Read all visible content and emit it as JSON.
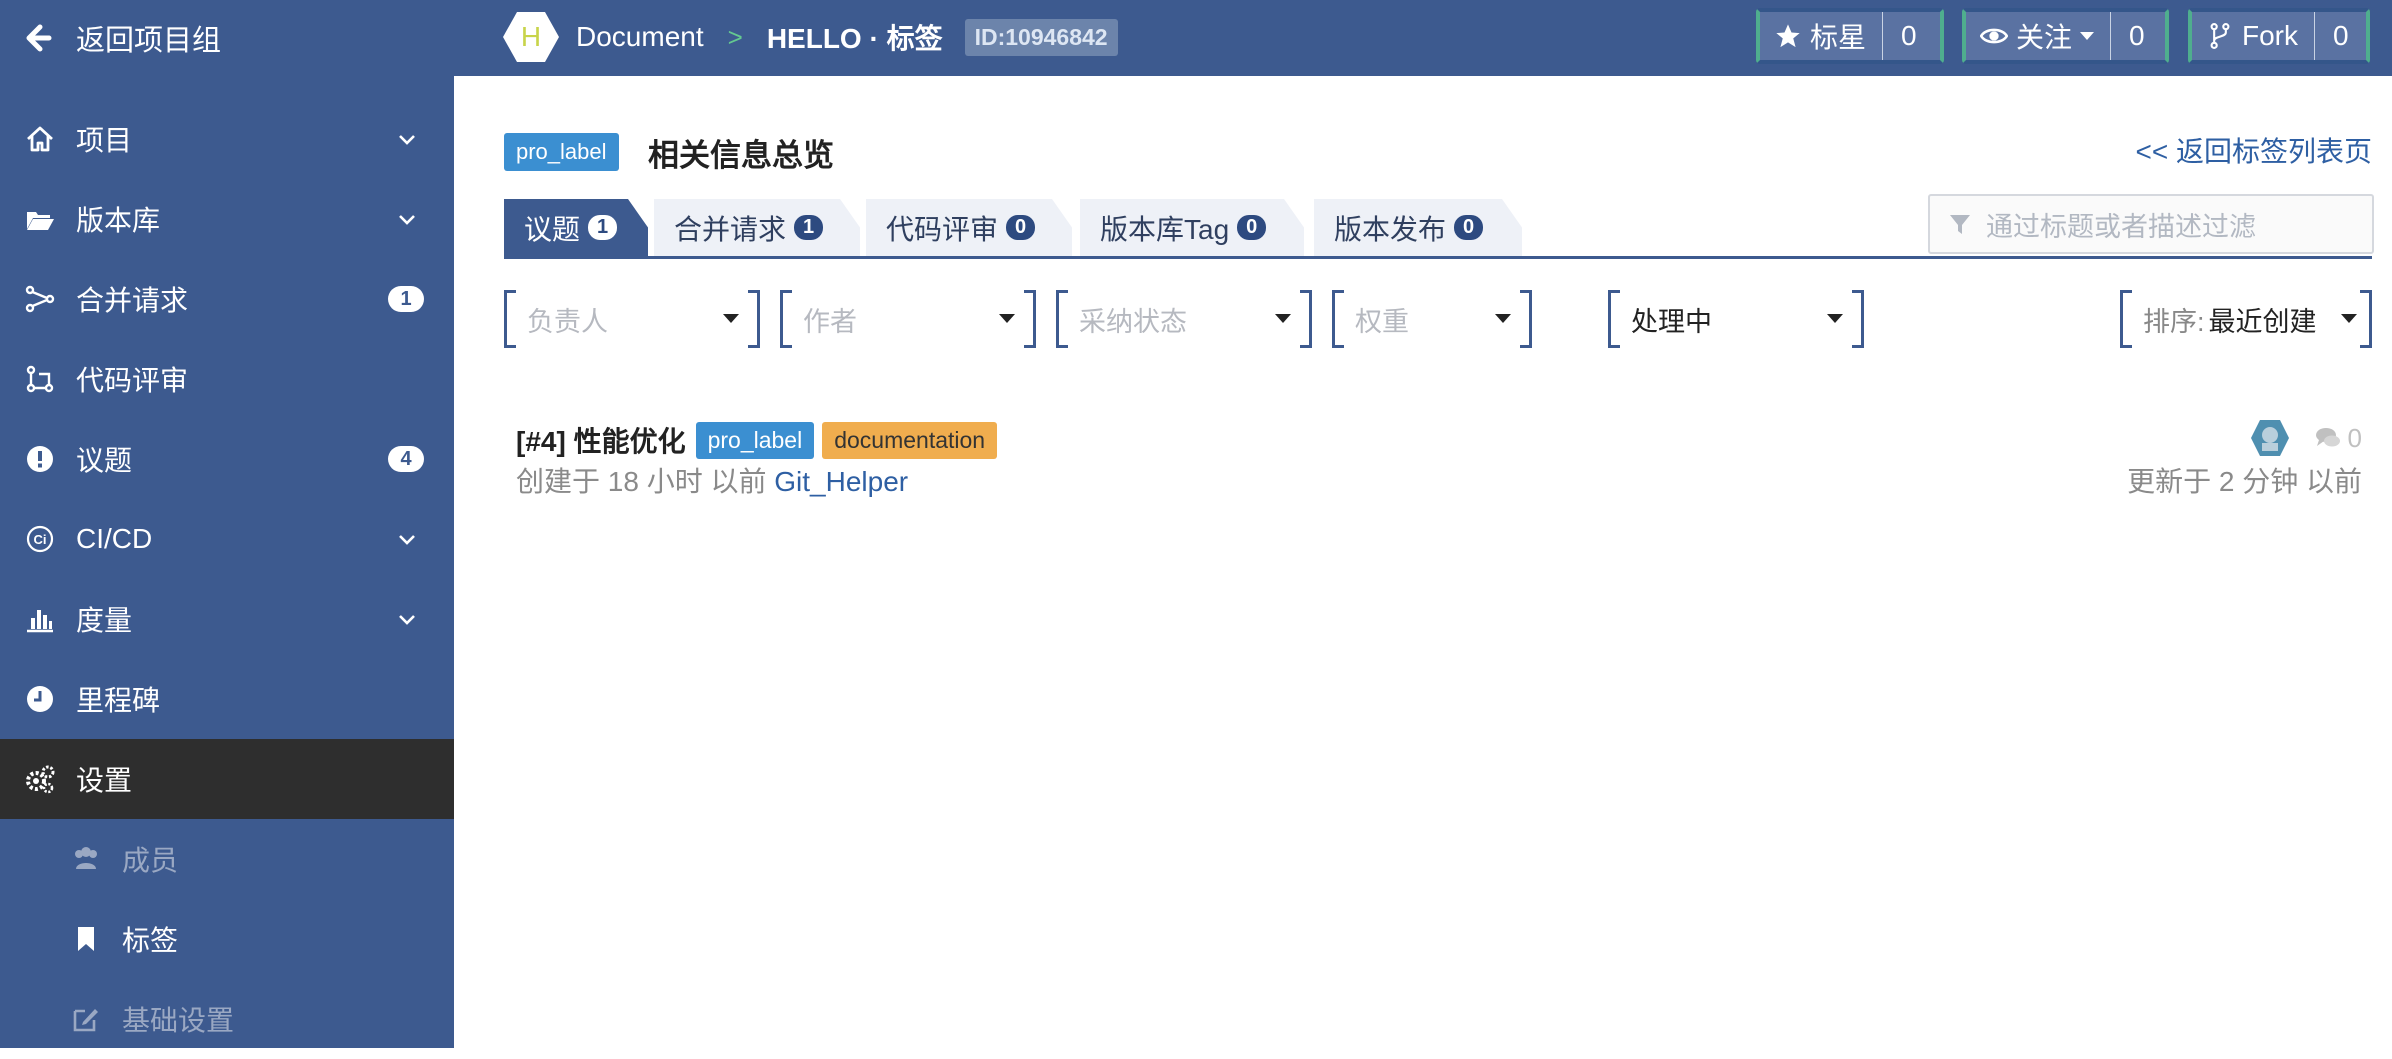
{
  "topbar": {
    "back_label": "返回项目组",
    "project_logo_letter": "H",
    "breadcrumb_group": "Document",
    "breadcrumb_sep": ">",
    "breadcrumb_current": "HELLO · 标签",
    "project_id": "ID:10946842",
    "star": {
      "label": "标星",
      "count": "0"
    },
    "watch": {
      "label": "关注",
      "count": "0"
    },
    "fork": {
      "label": "Fork",
      "count": "0"
    }
  },
  "sidebar": {
    "items": [
      {
        "label": "项目",
        "icon": "home-icon",
        "chevron": true
      },
      {
        "label": "版本库",
        "icon": "folder-open-icon",
        "chevron": true
      },
      {
        "label": "合并请求",
        "icon": "merge-request-icon",
        "badge": "1"
      },
      {
        "label": "代码评审",
        "icon": "code-review-icon"
      },
      {
        "label": "议题",
        "icon": "exclamation-circle-icon",
        "badge": "4"
      },
      {
        "label": "CI/CD",
        "icon": "ci-icon",
        "chevron": true
      },
      {
        "label": "度量",
        "icon": "bar-chart-icon",
        "chevron": true
      },
      {
        "label": "里程碑",
        "icon": "clock-icon"
      },
      {
        "label": "设置",
        "icon": "gears-icon",
        "active": true
      }
    ],
    "sub_items": [
      {
        "label": "成员",
        "icon": "users-icon"
      },
      {
        "label": "标签",
        "icon": "bookmark-icon"
      },
      {
        "label": "基础设置",
        "icon": "edit-icon"
      }
    ]
  },
  "main": {
    "label_name": "pro_label",
    "title": "相关信息总览",
    "back_link": "<< 返回标签列表页",
    "tabs": [
      {
        "label": "议题",
        "count": "1",
        "active": true
      },
      {
        "label": "合并请求",
        "count": "1"
      },
      {
        "label": "代码评审",
        "count": "0"
      },
      {
        "label": "版本库Tag",
        "count": "0"
      },
      {
        "label": "版本发布",
        "count": "0"
      }
    ],
    "filter_placeholder": "通过标题或者描述过滤",
    "dropdowns": {
      "assignee": "负责人",
      "author": "作者",
      "adoption": "采纳状态",
      "weight": "权重",
      "status": "处理中",
      "sort_prefix": "排序:",
      "sort_value": "最近创建"
    },
    "issue": {
      "title": "[#4] 性能优化",
      "labels": [
        {
          "name": "pro_label",
          "color": "#3b8fd1"
        },
        {
          "name": "documentation",
          "color": "#f0ad4e"
        }
      ],
      "created_prefix": "创建于 18 小时 以前",
      "author": "Git_Helper",
      "comment_count": "0",
      "updated": "更新于 2 分钟 以前"
    }
  },
  "colors": {
    "sidebar_bg": "#3d5a8f",
    "active_bg": "#2e2e2e",
    "link": "#2e5fa3"
  }
}
